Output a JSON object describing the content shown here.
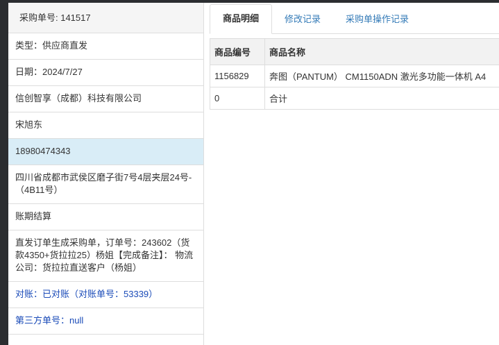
{
  "order": {
    "header": "采购单号: 141517",
    "fields": [
      "类型：供应商直发",
      "日期：2024/7/27",
      "信创智享（成都）科技有限公司",
      "宋旭东",
      "18980474343",
      "四川省成都市武侯区磨子街7号4层夹层24号-（4B11号）",
      "账期结算",
      "直发订单生成采购单，订单号：243602（货款4350+货拉拉25）杨姐【完成备注】： 物流公司：货拉拉直送客户（杨姐）",
      "对账：已对账（对账单号：53339）",
      "第三方单号：null"
    ]
  },
  "tabs": [
    "商品明细",
    "修改记录",
    "采购单操作记录"
  ],
  "table": {
    "headers": [
      "商品编号",
      "商品名称"
    ],
    "rows": [
      [
        "1156829",
        "奔图（PANTUM） CM1150ADN 激光多功能一体机 A4"
      ],
      [
        "0",
        "合计"
      ]
    ]
  },
  "colors": {
    "highlight_row": "#d9edf7",
    "link_text": "#1a4bb8",
    "tab_link": "#337ab7",
    "background_dark": "#2b2d30"
  }
}
